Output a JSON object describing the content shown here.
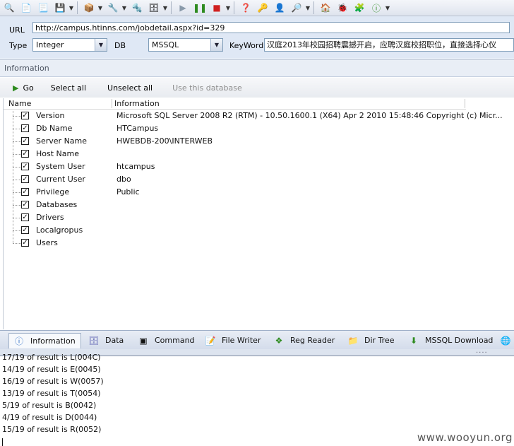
{
  "form": {
    "url_label": "URL",
    "url_value": "http://campus.htinns.com/jobdetail.aspx?id=329",
    "type_label": "Type",
    "type_value": "Integer",
    "db_label": "DB",
    "db_value": "MSSQL",
    "keyword_label": "KeyWord",
    "keyword_value": "汉庭2013年校园招聘震撼开启，应聘汉庭校招职位，直接选择心仪"
  },
  "panel": {
    "title": "Information",
    "actions": {
      "go": "Go",
      "select_all": "Select all",
      "unselect_all": "Unselect all",
      "use_db": "Use this database"
    },
    "columns": {
      "name": "Name",
      "info": "Information"
    },
    "rows": [
      {
        "name": "Version",
        "info": "Microsoft SQL Server 2008 R2 (RTM) - 10.50.1600.1 (X64) Apr  2 2010 15:48:46 Copyright (c) Micr..."
      },
      {
        "name": "Db Name",
        "info": "HTCampus"
      },
      {
        "name": "Server Name",
        "info": "HWEBDB-200\\INTERWEB"
      },
      {
        "name": "Host Name",
        "info": ""
      },
      {
        "name": "System User",
        "info": "htcampus"
      },
      {
        "name": "Current User",
        "info": "dbo"
      },
      {
        "name": "Privilege",
        "info": "Public"
      },
      {
        "name": "Databases",
        "info": ""
      },
      {
        "name": "Drivers",
        "info": ""
      },
      {
        "name": "Localgropus",
        "info": ""
      },
      {
        "name": "Users",
        "info": ""
      }
    ]
  },
  "tabs": [
    {
      "label": "Information",
      "icon": "info-icon"
    },
    {
      "label": "Data",
      "icon": "database-icon"
    },
    {
      "label": "Command",
      "icon": "terminal-icon"
    },
    {
      "label": "File Writer",
      "icon": "file-writer-icon"
    },
    {
      "label": "Reg Reader",
      "icon": "registry-icon"
    },
    {
      "label": "Dir Tree",
      "icon": "folder-icon"
    },
    {
      "label": "MSSQL Download",
      "icon": "download-icon"
    }
  ],
  "log": [
    "17/19 of result is L(004C)",
    "14/19 of result is E(0045)",
    "16/19 of result is W(0057)",
    "13/19 of result is T(0054)",
    "5/19 of result is B(0042)",
    "4/19 of result is D(0044)",
    "15/19 of result is R(0052)"
  ],
  "watermark": "www.wooyun.org",
  "colors": {
    "form_bg": "#dfe8f5",
    "go_green": "#2e8b1f"
  }
}
